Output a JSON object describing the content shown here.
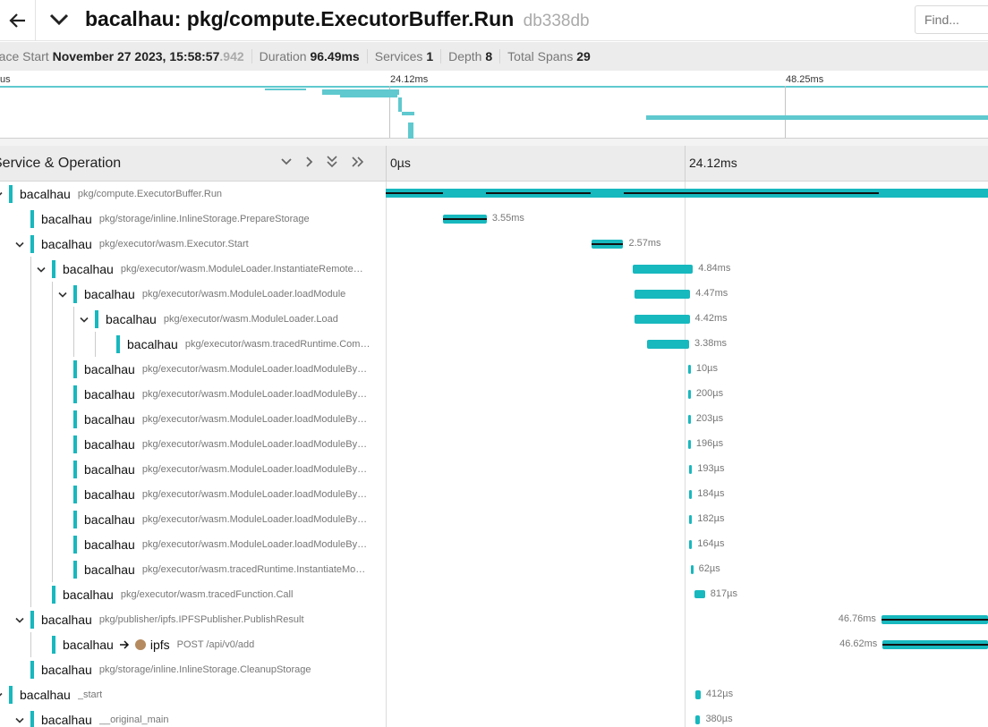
{
  "header": {
    "back_icon": "arrow-left-icon",
    "service": "bacalhau:",
    "operation": "pkg/compute.ExecutorBuffer.Run",
    "trace_id": "db338db",
    "find_placeholder": "Find..."
  },
  "meta": {
    "trace_start_label": "race Start",
    "trace_start_value": "November 27 2023, 15:58:57",
    "trace_start_ms": ".942",
    "duration_label": "Duration",
    "duration_value": "96.49ms",
    "services_label": "Services",
    "services_value": "1",
    "depth_label": "Depth",
    "depth_value": "8",
    "total_spans_label": "Total Spans",
    "total_spans_value": "29"
  },
  "minimap": {
    "ticks": [
      "us",
      "24.12ms",
      "48.25ms"
    ]
  },
  "table": {
    "column_title": "Service & Operation",
    "ticks": [
      "0µs",
      "24.12ms"
    ]
  },
  "accent_color": "#17b8be",
  "spans": [
    {
      "service": "bacalhau",
      "operation": "pkg/compute.ExecutorBuffer.Run",
      "duration": "",
      "depth": 0,
      "chevron": "v",
      "start_ms": 0,
      "dur_ms": 96.49,
      "label_side": "none"
    },
    {
      "service": "bacalhau",
      "operation": "pkg/storage/inline.InlineStorage.PrepareStorage",
      "duration": "3.55ms",
      "depth": 1,
      "chevron": "",
      "start_ms": 4.6,
      "dur_ms": 3.55,
      "label_side": "right"
    },
    {
      "service": "bacalhau",
      "operation": "pkg/executor/wasm.Executor.Start",
      "duration": "2.57ms",
      "depth": 1,
      "chevron": "v",
      "start_ms": 16.6,
      "dur_ms": 2.57,
      "label_side": "right"
    },
    {
      "service": "bacalhau",
      "operation": "pkg/executor/wasm.ModuleLoader.InstantiateRemote…",
      "duration": "4.84ms",
      "depth": 2,
      "chevron": "v",
      "start_ms": 19.95,
      "dur_ms": 4.84,
      "label_side": "right"
    },
    {
      "service": "bacalhau",
      "operation": "pkg/executor/wasm.ModuleLoader.loadModule",
      "duration": "4.47ms",
      "depth": 3,
      "chevron": "v",
      "start_ms": 20.1,
      "dur_ms": 4.47,
      "label_side": "right"
    },
    {
      "service": "bacalhau",
      "operation": "pkg/executor/wasm.ModuleLoader.Load",
      "duration": "4.42ms",
      "depth": 4,
      "chevron": "v",
      "start_ms": 20.1,
      "dur_ms": 4.42,
      "label_side": "right"
    },
    {
      "service": "bacalhau",
      "operation": "pkg/executor/wasm.tracedRuntime.Com…",
      "duration": "3.38ms",
      "depth": 5,
      "chevron": "",
      "start_ms": 21.1,
      "dur_ms": 3.38,
      "label_side": "right"
    },
    {
      "service": "bacalhau",
      "operation": "pkg/executor/wasm.ModuleLoader.loadModuleBy…",
      "duration": "10µs",
      "depth": 3,
      "chevron": "",
      "start_ms": 24.4,
      "dur_ms": 0.01,
      "label_side": "right"
    },
    {
      "service": "bacalhau",
      "operation": "pkg/executor/wasm.ModuleLoader.loadModuleBy…",
      "duration": "200µs",
      "depth": 3,
      "chevron": "",
      "start_ms": 24.4,
      "dur_ms": 0.2,
      "label_side": "right"
    },
    {
      "service": "bacalhau",
      "operation": "pkg/executor/wasm.ModuleLoader.loadModuleBy…",
      "duration": "203µs",
      "depth": 3,
      "chevron": "",
      "start_ms": 24.4,
      "dur_ms": 0.203,
      "label_side": "right"
    },
    {
      "service": "bacalhau",
      "operation": "pkg/executor/wasm.ModuleLoader.loadModuleBy…",
      "duration": "196µs",
      "depth": 3,
      "chevron": "",
      "start_ms": 24.4,
      "dur_ms": 0.196,
      "label_side": "right"
    },
    {
      "service": "bacalhau",
      "operation": "pkg/executor/wasm.ModuleLoader.loadModuleBy…",
      "duration": "193µs",
      "depth": 3,
      "chevron": "",
      "start_ms": 24.5,
      "dur_ms": 0.193,
      "label_side": "right"
    },
    {
      "service": "bacalhau",
      "operation": "pkg/executor/wasm.ModuleLoader.loadModuleBy…",
      "duration": "184µs",
      "depth": 3,
      "chevron": "",
      "start_ms": 24.5,
      "dur_ms": 0.184,
      "label_side": "right"
    },
    {
      "service": "bacalhau",
      "operation": "pkg/executor/wasm.ModuleLoader.loadModuleBy…",
      "duration": "182µs",
      "depth": 3,
      "chevron": "",
      "start_ms": 24.5,
      "dur_ms": 0.182,
      "label_side": "right"
    },
    {
      "service": "bacalhau",
      "operation": "pkg/executor/wasm.ModuleLoader.loadModuleBy…",
      "duration": "164µs",
      "depth": 3,
      "chevron": "",
      "start_ms": 24.5,
      "dur_ms": 0.164,
      "label_side": "right"
    },
    {
      "service": "bacalhau",
      "operation": "pkg/executor/wasm.tracedRuntime.InstantiateMo…",
      "duration": "62µs",
      "depth": 3,
      "chevron": "",
      "start_ms": 24.6,
      "dur_ms": 0.062,
      "label_side": "right"
    },
    {
      "service": "bacalhau",
      "operation": "pkg/executor/wasm.tracedFunction.Call",
      "duration": "817µs",
      "depth": 2,
      "chevron": "",
      "start_ms": 24.95,
      "dur_ms": 0.817,
      "label_side": "right"
    },
    {
      "service": "bacalhau",
      "operation": "pkg/publisher/ipfs.IPFSPublisher.PublishResult",
      "duration": "46.76ms",
      "depth": 1,
      "chevron": "v",
      "start_ms": 40.0,
      "dur_ms": 46.76,
      "label_side": "left"
    },
    {
      "service": "bacalhau",
      "operation": "POST /api/v0/add",
      "duration": "46.62ms",
      "depth": 2,
      "chevron": "",
      "start_ms": 40.1,
      "dur_ms": 46.62,
      "label_side": "left",
      "remote_service": "ipfs"
    },
    {
      "service": "bacalhau",
      "operation": "pkg/storage/inline.InlineStorage.CleanupStorage",
      "duration": "",
      "depth": 1,
      "chevron": "",
      "start_ms": 0,
      "dur_ms": 0,
      "label_side": "none"
    },
    {
      "service": "bacalhau",
      "operation": "_start",
      "duration": "412µs",
      "depth": 0,
      "chevron": "v",
      "start_ms": 25.0,
      "dur_ms": 0.412,
      "label_side": "right"
    },
    {
      "service": "bacalhau",
      "operation": "__original_main",
      "duration": "380µs",
      "depth": 1,
      "chevron": "v",
      "start_ms": 25.0,
      "dur_ms": 0.38,
      "label_side": "right"
    }
  ]
}
